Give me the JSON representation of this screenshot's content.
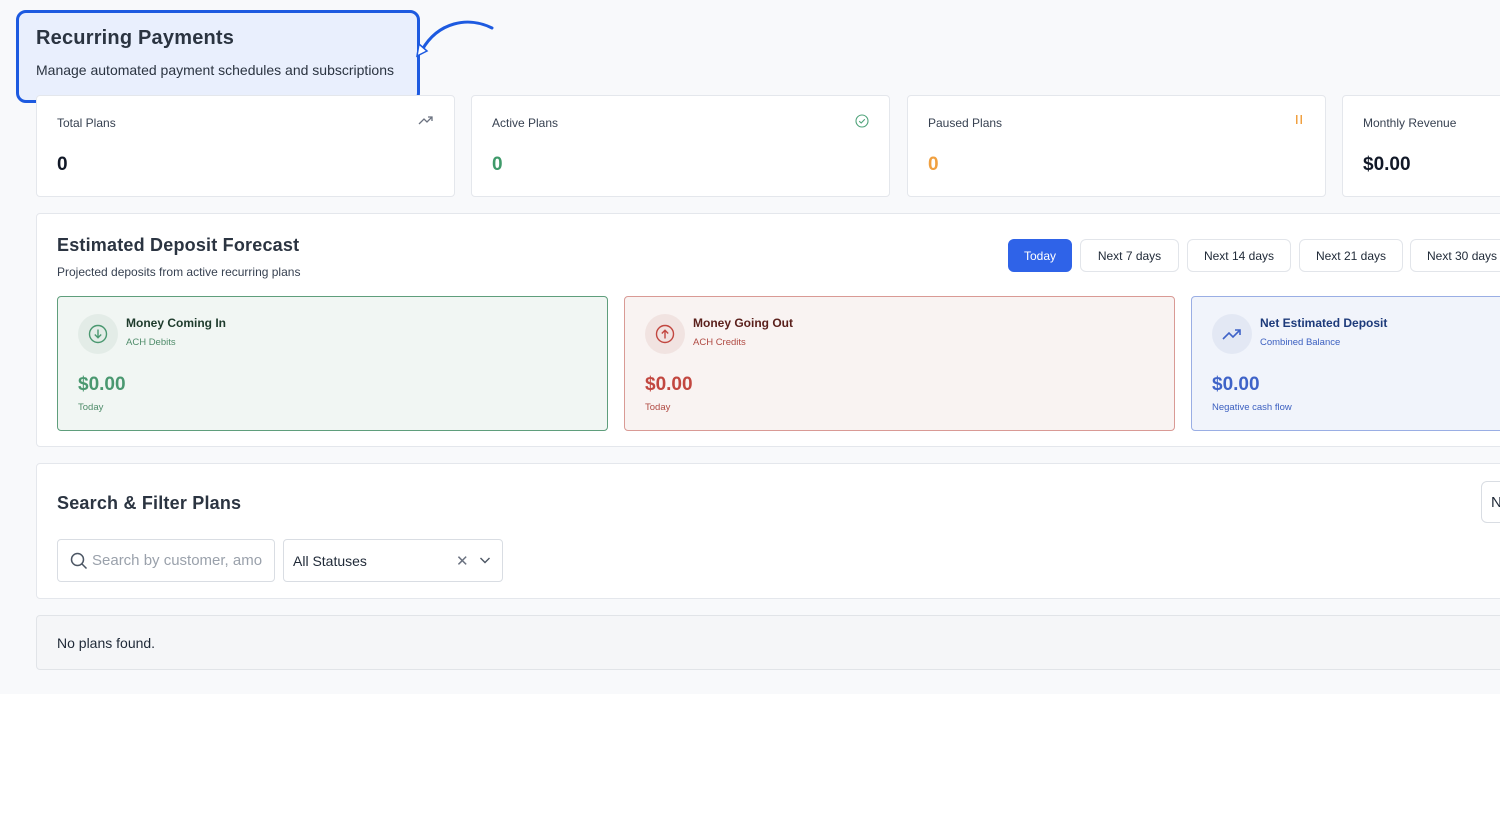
{
  "header": {
    "title": "Recurring Payments",
    "subtitle": "Manage automated payment schedules and subscriptions"
  },
  "stats": [
    {
      "label": "Total Plans",
      "value": "0",
      "icon": "trending-up-icon",
      "color": "#111827",
      "icon_color": "#6b7280"
    },
    {
      "label": "Active Plans",
      "value": "0",
      "icon": "check-circle-icon",
      "color": "#3f9a6a",
      "icon_color": "#4fa37a"
    },
    {
      "label": "Paused Plans",
      "value": "0",
      "icon": "pause-icon",
      "color": "#f0a040",
      "icon_color": "#f0a040"
    },
    {
      "label": "Monthly Revenue",
      "value": "$0.00",
      "icon": "",
      "color": "#111827",
      "icon_color": ""
    }
  ],
  "forecast": {
    "title": "Estimated Deposit Forecast",
    "subtitle": "Projected deposits from active recurring plans",
    "ranges": [
      "Today",
      "Next 7 days",
      "Next 14 days",
      "Next 21 days",
      "Next 30 days"
    ],
    "active_range": "Today",
    "cards": {
      "in": {
        "title": "Money Coming In",
        "sub": "ACH Debits",
        "amount": "$0.00",
        "note": "Today",
        "icon": "arrow-down-circle-icon"
      },
      "out": {
        "title": "Money Going Out",
        "sub": "ACH Credits",
        "amount": "$0.00",
        "note": "Today",
        "icon": "arrow-up-circle-icon"
      },
      "net": {
        "title": "Net Estimated Deposit",
        "sub": "Combined Balance",
        "amount": "$0.00",
        "note": "Negative cash flow",
        "icon": "trending-up-icon"
      }
    }
  },
  "filter": {
    "title": "Search & Filter Plans",
    "new_button_label": "N",
    "search_placeholder": "Search by customer, amount...",
    "status_value": "All Statuses"
  },
  "empty_state": "No plans found.",
  "colors": {
    "accent": "#2f63e8",
    "highlight_border": "#1d5ae0"
  }
}
